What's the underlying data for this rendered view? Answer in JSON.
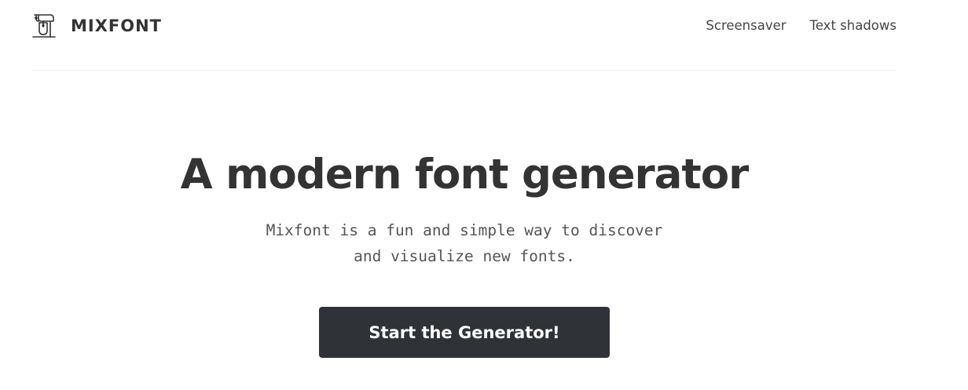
{
  "header": {
    "logo_text": "MIXFONT",
    "logo_icon": "stand-mixer-icon",
    "nav": [
      {
        "label": "Screensaver"
      },
      {
        "label": "Text shadows"
      }
    ]
  },
  "hero": {
    "title": "A modern font generator",
    "subtitle_line1": "Mixfont is a fun and simple way to discover",
    "subtitle_line2": "and visualize new fonts.",
    "cta_label": "Start the Generator!"
  },
  "colors": {
    "text": "#333333",
    "button_bg": "#2f3338",
    "button_text": "#ffffff",
    "divider": "#eeeeee"
  }
}
